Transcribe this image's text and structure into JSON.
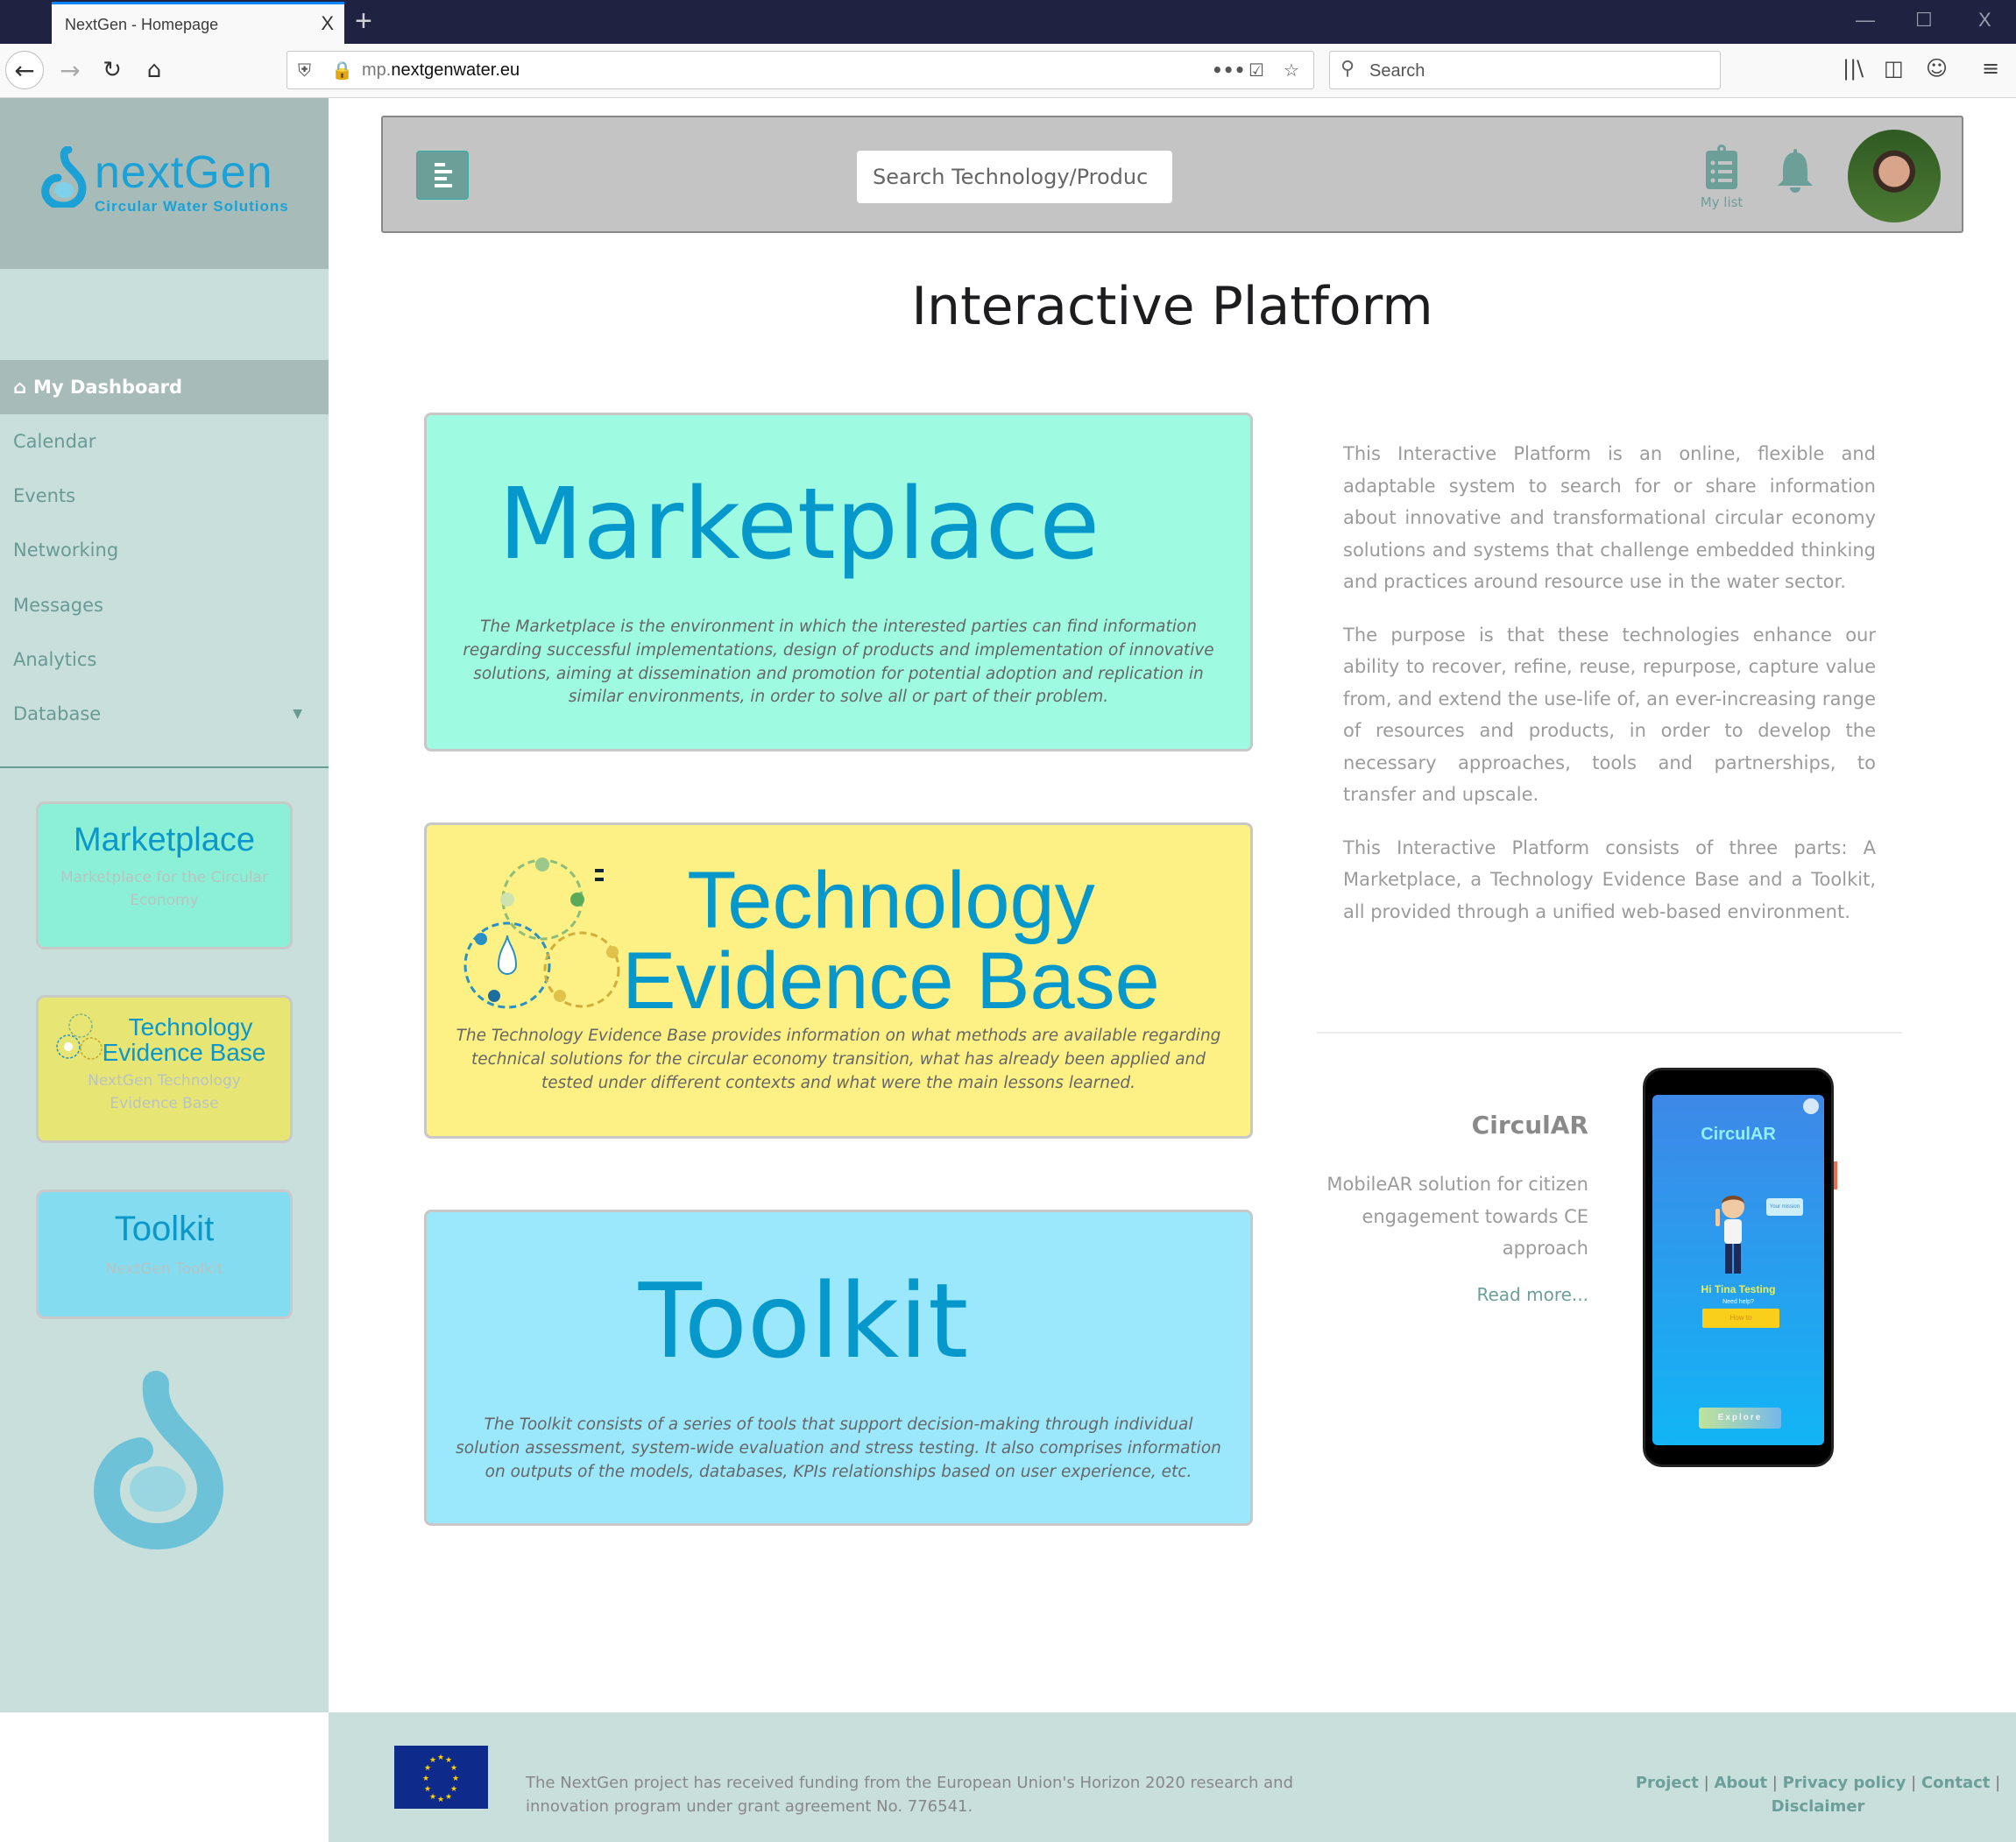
{
  "browser": {
    "tab_title": "NextGen - Homepage",
    "tab_close": "X",
    "new_tab": "+",
    "url_dim": "mp.",
    "url_main": "nextgenwater.eu",
    "search_placeholder": "Search",
    "window_controls": {
      "minimize": "—",
      "maximize": "☐",
      "close": "X"
    }
  },
  "sidebar": {
    "logo_name": "nextGen",
    "logo_tagline": "Circular Water Solutions",
    "items": [
      {
        "label": "My Dashboard",
        "active": true
      },
      {
        "label": "Calendar"
      },
      {
        "label": "Events"
      },
      {
        "label": "Networking"
      },
      {
        "label": "Messages"
      },
      {
        "label": "Analytics"
      },
      {
        "label": "Database"
      }
    ],
    "cards": [
      {
        "title": "Marketplace",
        "subtitle": "Marketplace for the Circular Economy",
        "color": "#8cf0d6"
      },
      {
        "title_line1": "Technology",
        "title_line2": "Evidence Base",
        "subtitle": "NextGen Technology Evidence Base",
        "color": "#e7e574"
      },
      {
        "title": "Toolkit",
        "subtitle": "NextGen Toolkit",
        "color": "#84dcf0"
      }
    ]
  },
  "header": {
    "search_placeholder": "Search Technology/Produc",
    "mylist_label": "My list"
  },
  "main": {
    "title": "Interactive Platform",
    "cards": [
      {
        "title": "Marketplace",
        "description": "The Marketplace is the environment in which the interested parties can find information regarding successful implementations, design of products and implementation of innovative solutions, aiming at dissemination and promotion for potential adoption and replication in similar environments, in order to solve all or part of their problem.",
        "color": "#9ffae2"
      },
      {
        "title_line1": "Technology",
        "title_line2": "Evidence Base",
        "description": "The Technology Evidence Base provides information on what methods are available regarding technical solutions for the circular economy transition, what has already been applied and tested under different contexts and what were the main lessons learned.",
        "color": "#fdf084"
      },
      {
        "title": "Toolkit",
        "description": "The Toolkit consists of a series of tools that support decision-making through individual solution assessment, system-wide evaluation and stress testing. It also comprises information on outputs of the models, databases, KPIs relationships based on user experience, etc.",
        "color": "#9be8fc"
      }
    ],
    "intro_paragraphs": [
      "This Interactive Platform is an online, flexible and adaptable system to search for or share information about innovative and transformational circular economy solutions and systems that challenge embedded thinking and practices around resource use in the water sector.",
      "The purpose is that these technologies enhance our ability to recover, refine, reuse, repurpose, capture value from, and extend the use-life of, an ever-increasing range of resources and products, in order to develop the necessary approaches, tools and partnerships, to transfer and upscale.",
      "This Interactive Platform consists of three parts: A Marketplace, a Technology Evidence Base and a Toolkit, all provided through a unified web-based environment."
    ],
    "circular": {
      "title": "CirculAR",
      "description": "MobileAR solution for citizen engagement towards CE approach",
      "read_more": "Read more...",
      "phone": {
        "app_title": "CirculAR",
        "bubble": "Your mission",
        "greeting": "Hi Tina Testing",
        "help": "Need help?",
        "howto": "How to",
        "explore": "Explore"
      }
    }
  },
  "footer": {
    "funding_text": "The NextGen project has received funding from the European Union's Horizon 2020 research and innovation program under grant agreement No. 776541.",
    "links": [
      "Project",
      "About",
      "Privacy policy",
      "Contact",
      "Disclaimer"
    ],
    "separator": "|"
  },
  "colors": {
    "accent": "#6b9f98",
    "brand_blue": "#0698cb",
    "sidebar_bg": "#c8dfdc",
    "sidebar_active": "#a7bcb9"
  }
}
